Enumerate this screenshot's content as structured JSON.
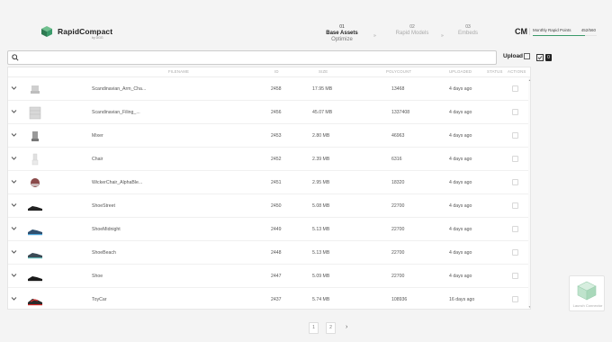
{
  "app": {
    "name": "RapidCompact",
    "sub": "by DGG",
    "brand_color": "#3a9a6a"
  },
  "steps": [
    {
      "num": "01",
      "label": "Base Assets",
      "sublabel": "Optimize",
      "active": true
    },
    {
      "num": "02",
      "label": "Rapid Models",
      "sublabel": "",
      "active": false
    },
    {
      "num": "03",
      "label": "Embeds",
      "sublabel": "",
      "active": false
    }
  ],
  "step_separator": "»",
  "user": {
    "initials": "CM",
    "points_label": "Monthly Rapid Points",
    "points_value": "452/560",
    "points_fraction": 0.81
  },
  "toolbar": {
    "search_placeholder": "",
    "upload_label": "Upload",
    "selected_count": "0"
  },
  "table": {
    "columns": [
      "FILENAME",
      "ID",
      "SIZE",
      "POLYCOUNT",
      "UPLOADED",
      "STATUS",
      "ACTIONS"
    ],
    "rows": [
      {
        "thumb": "armchair",
        "filename": "Scandinavian_Arm_Cha...",
        "id": "2458",
        "size": "17.95 MB",
        "polycount": "13468",
        "uploaded": "4 days ago"
      },
      {
        "thumb": "cabinet",
        "filename": "Scandinavian_Filing_...",
        "id": "2456",
        "size": "45.07 MB",
        "polycount": "1337408",
        "uploaded": "4 days ago"
      },
      {
        "thumb": "mixer",
        "filename": "Mixer",
        "id": "2453",
        "size": "2.80 MB",
        "polycount": "46963",
        "uploaded": "4 days ago"
      },
      {
        "thumb": "chair",
        "filename": "Chair",
        "id": "2452",
        "size": "2.39 MB",
        "polycount": "6316",
        "uploaded": "4 days ago"
      },
      {
        "thumb": "helmet",
        "filename": "WickerChair_AlphaBle...",
        "id": "2451",
        "size": "2.95 MB",
        "polycount": "18320",
        "uploaded": "4 days ago"
      },
      {
        "thumb": "shoe-black",
        "filename": "ShoeStreet",
        "id": "2450",
        "size": "5.08 MB",
        "polycount": "22700",
        "uploaded": "4 days ago"
      },
      {
        "thumb": "shoe-blue",
        "filename": "ShoeMidnight",
        "id": "2449",
        "size": "5.13 MB",
        "polycount": "22700",
        "uploaded": "4 days ago"
      },
      {
        "thumb": "shoe-teal",
        "filename": "ShoeBeach",
        "id": "2448",
        "size": "5.13 MB",
        "polycount": "22700",
        "uploaded": "4 days ago"
      },
      {
        "thumb": "shoe-black2",
        "filename": "Shoe",
        "id": "2447",
        "size": "5.09 MB",
        "polycount": "22700",
        "uploaded": "4 days ago"
      },
      {
        "thumb": "shoe-red",
        "filename": "ToyCar",
        "id": "2437",
        "size": "5.74 MB",
        "polycount": "108936",
        "uploaded": "16 days ago"
      }
    ]
  },
  "pagination": {
    "pages": [
      "1",
      "2"
    ],
    "current": "1"
  },
  "launch": {
    "label": "Launch Connector"
  }
}
